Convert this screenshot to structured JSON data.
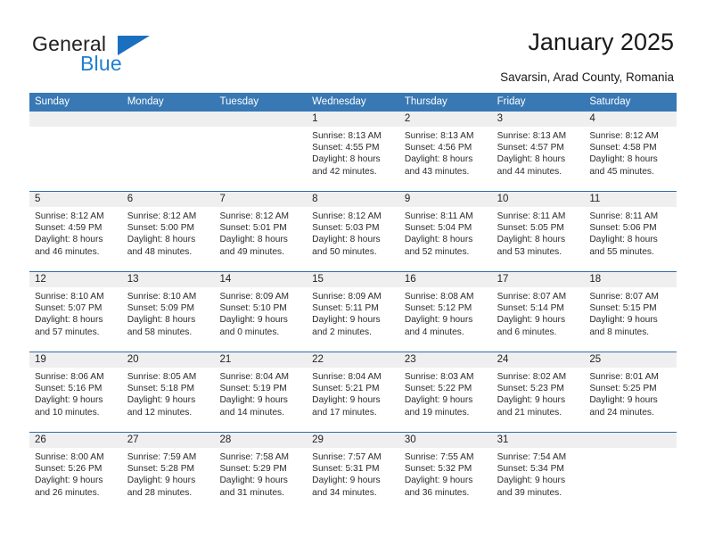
{
  "brand": {
    "name_part1": "General",
    "name_part2": "Blue",
    "accent_color": "#1a6fc0"
  },
  "header": {
    "title": "January 2025",
    "subtitle": "Savarsin, Arad County, Romania"
  },
  "calendar": {
    "header_bg": "#3878b4",
    "row_divider": "#2f6ea8",
    "daynum_bg": "#efeff0",
    "weekdays": [
      "Sunday",
      "Monday",
      "Tuesday",
      "Wednesday",
      "Thursday",
      "Friday",
      "Saturday"
    ],
    "weeks": [
      [
        {
          "day": "",
          "lines": []
        },
        {
          "day": "",
          "lines": []
        },
        {
          "day": "",
          "lines": []
        },
        {
          "day": "1",
          "lines": [
            "Sunrise: 8:13 AM",
            "Sunset: 4:55 PM",
            "Daylight: 8 hours",
            "and 42 minutes."
          ]
        },
        {
          "day": "2",
          "lines": [
            "Sunrise: 8:13 AM",
            "Sunset: 4:56 PM",
            "Daylight: 8 hours",
            "and 43 minutes."
          ]
        },
        {
          "day": "3",
          "lines": [
            "Sunrise: 8:13 AM",
            "Sunset: 4:57 PM",
            "Daylight: 8 hours",
            "and 44 minutes."
          ]
        },
        {
          "day": "4",
          "lines": [
            "Sunrise: 8:12 AM",
            "Sunset: 4:58 PM",
            "Daylight: 8 hours",
            "and 45 minutes."
          ]
        }
      ],
      [
        {
          "day": "5",
          "lines": [
            "Sunrise: 8:12 AM",
            "Sunset: 4:59 PM",
            "Daylight: 8 hours",
            "and 46 minutes."
          ]
        },
        {
          "day": "6",
          "lines": [
            "Sunrise: 8:12 AM",
            "Sunset: 5:00 PM",
            "Daylight: 8 hours",
            "and 48 minutes."
          ]
        },
        {
          "day": "7",
          "lines": [
            "Sunrise: 8:12 AM",
            "Sunset: 5:01 PM",
            "Daylight: 8 hours",
            "and 49 minutes."
          ]
        },
        {
          "day": "8",
          "lines": [
            "Sunrise: 8:12 AM",
            "Sunset: 5:03 PM",
            "Daylight: 8 hours",
            "and 50 minutes."
          ]
        },
        {
          "day": "9",
          "lines": [
            "Sunrise: 8:11 AM",
            "Sunset: 5:04 PM",
            "Daylight: 8 hours",
            "and 52 minutes."
          ]
        },
        {
          "day": "10",
          "lines": [
            "Sunrise: 8:11 AM",
            "Sunset: 5:05 PM",
            "Daylight: 8 hours",
            "and 53 minutes."
          ]
        },
        {
          "day": "11",
          "lines": [
            "Sunrise: 8:11 AM",
            "Sunset: 5:06 PM",
            "Daylight: 8 hours",
            "and 55 minutes."
          ]
        }
      ],
      [
        {
          "day": "12",
          "lines": [
            "Sunrise: 8:10 AM",
            "Sunset: 5:07 PM",
            "Daylight: 8 hours",
            "and 57 minutes."
          ]
        },
        {
          "day": "13",
          "lines": [
            "Sunrise: 8:10 AM",
            "Sunset: 5:09 PM",
            "Daylight: 8 hours",
            "and 58 minutes."
          ]
        },
        {
          "day": "14",
          "lines": [
            "Sunrise: 8:09 AM",
            "Sunset: 5:10 PM",
            "Daylight: 9 hours",
            "and 0 minutes."
          ]
        },
        {
          "day": "15",
          "lines": [
            "Sunrise: 8:09 AM",
            "Sunset: 5:11 PM",
            "Daylight: 9 hours",
            "and 2 minutes."
          ]
        },
        {
          "day": "16",
          "lines": [
            "Sunrise: 8:08 AM",
            "Sunset: 5:12 PM",
            "Daylight: 9 hours",
            "and 4 minutes."
          ]
        },
        {
          "day": "17",
          "lines": [
            "Sunrise: 8:07 AM",
            "Sunset: 5:14 PM",
            "Daylight: 9 hours",
            "and 6 minutes."
          ]
        },
        {
          "day": "18",
          "lines": [
            "Sunrise: 8:07 AM",
            "Sunset: 5:15 PM",
            "Daylight: 9 hours",
            "and 8 minutes."
          ]
        }
      ],
      [
        {
          "day": "19",
          "lines": [
            "Sunrise: 8:06 AM",
            "Sunset: 5:16 PM",
            "Daylight: 9 hours",
            "and 10 minutes."
          ]
        },
        {
          "day": "20",
          "lines": [
            "Sunrise: 8:05 AM",
            "Sunset: 5:18 PM",
            "Daylight: 9 hours",
            "and 12 minutes."
          ]
        },
        {
          "day": "21",
          "lines": [
            "Sunrise: 8:04 AM",
            "Sunset: 5:19 PM",
            "Daylight: 9 hours",
            "and 14 minutes."
          ]
        },
        {
          "day": "22",
          "lines": [
            "Sunrise: 8:04 AM",
            "Sunset: 5:21 PM",
            "Daylight: 9 hours",
            "and 17 minutes."
          ]
        },
        {
          "day": "23",
          "lines": [
            "Sunrise: 8:03 AM",
            "Sunset: 5:22 PM",
            "Daylight: 9 hours",
            "and 19 minutes."
          ]
        },
        {
          "day": "24",
          "lines": [
            "Sunrise: 8:02 AM",
            "Sunset: 5:23 PM",
            "Daylight: 9 hours",
            "and 21 minutes."
          ]
        },
        {
          "day": "25",
          "lines": [
            "Sunrise: 8:01 AM",
            "Sunset: 5:25 PM",
            "Daylight: 9 hours",
            "and 24 minutes."
          ]
        }
      ],
      [
        {
          "day": "26",
          "lines": [
            "Sunrise: 8:00 AM",
            "Sunset: 5:26 PM",
            "Daylight: 9 hours",
            "and 26 minutes."
          ]
        },
        {
          "day": "27",
          "lines": [
            "Sunrise: 7:59 AM",
            "Sunset: 5:28 PM",
            "Daylight: 9 hours",
            "and 28 minutes."
          ]
        },
        {
          "day": "28",
          "lines": [
            "Sunrise: 7:58 AM",
            "Sunset: 5:29 PM",
            "Daylight: 9 hours",
            "and 31 minutes."
          ]
        },
        {
          "day": "29",
          "lines": [
            "Sunrise: 7:57 AM",
            "Sunset: 5:31 PM",
            "Daylight: 9 hours",
            "and 34 minutes."
          ]
        },
        {
          "day": "30",
          "lines": [
            "Sunrise: 7:55 AM",
            "Sunset: 5:32 PM",
            "Daylight: 9 hours",
            "and 36 minutes."
          ]
        },
        {
          "day": "31",
          "lines": [
            "Sunrise: 7:54 AM",
            "Sunset: 5:34 PM",
            "Daylight: 9 hours",
            "and 39 minutes."
          ]
        },
        {
          "day": "",
          "lines": []
        }
      ]
    ]
  }
}
